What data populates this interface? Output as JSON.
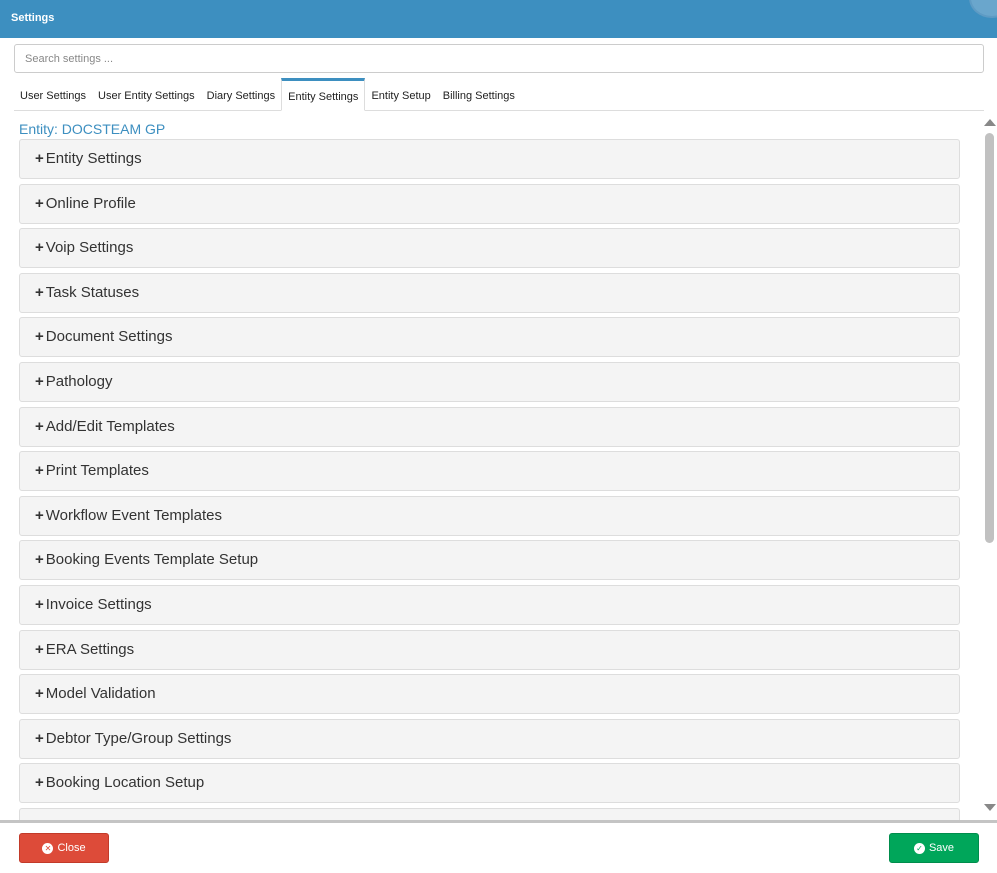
{
  "header": {
    "title": "Settings"
  },
  "search": {
    "placeholder": "Search settings ..."
  },
  "tabs": [
    "User Settings",
    "User Entity Settings",
    "Diary Settings",
    "Entity Settings",
    "Entity Setup",
    "Billing Settings"
  ],
  "active_tab": "Entity Settings",
  "entity_label": "Entity: DOCSTEAM GP",
  "expand_symbol": "+",
  "panels": [
    "Entity Settings",
    "Online Profile",
    "Voip Settings",
    "Task Statuses",
    "Document Settings",
    "Pathology",
    "Add/Edit Templates",
    "Print Templates",
    "Workflow Event Templates",
    "Booking Events Template Setup",
    "Invoice Settings",
    "ERA Settings",
    "Model Validation",
    "Debtor Type/Group Settings",
    "Booking Location Setup"
  ],
  "footer": {
    "close_label": "Close",
    "save_label": "Save"
  },
  "colors": {
    "header": "#3d8fc0",
    "close": "#dd4b39",
    "save": "#00a65a"
  }
}
